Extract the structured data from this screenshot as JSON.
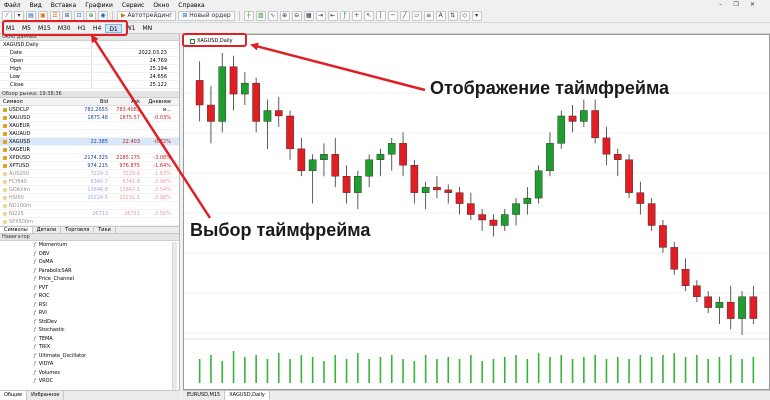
{
  "menu": [
    "Файл",
    "Вид",
    "Вставка",
    "Графики",
    "Сервис",
    "Окно",
    "Справка"
  ],
  "toolbar": {
    "algo_label": "Автотрейдинг",
    "new_order_label": "Новый ордер"
  },
  "timeframes": [
    "M1",
    "M5",
    "M15",
    "M30",
    "H1",
    "H4",
    "D1",
    "W1",
    "MN"
  ],
  "active_timeframe": "D1",
  "data_window": {
    "title": "Окно данных",
    "symbol": "XAGUSD,Daily",
    "rows": [
      {
        "k": "Date",
        "v": "2022.03.23"
      },
      {
        "k": "Open",
        "v": "24.769"
      },
      {
        "k": "High",
        "v": "25.194"
      },
      {
        "k": "Low",
        "v": "24.656"
      },
      {
        "k": "Close",
        "v": "25.122"
      }
    ]
  },
  "market_watch": {
    "title": "Обзор рынка: 19:38:36",
    "headers": [
      "Символ",
      "Bid",
      "Ask",
      "Дневное и..."
    ],
    "rows": [
      {
        "s": "USDCLP",
        "b": "782.2655",
        "a": "783.4083",
        "d": "",
        "dim": false
      },
      {
        "s": "XAUUSD",
        "b": "1875.48",
        "a": "1875.57",
        "d": "-0.03%",
        "dim": false
      },
      {
        "s": "XAUEUR",
        "b": "",
        "a": "",
        "d": "",
        "dim": false
      },
      {
        "s": "XAUAUD",
        "b": "",
        "a": "",
        "d": "",
        "dim": false
      },
      {
        "s": "XAGUSD",
        "b": "22.385",
        "a": "22.403",
        "d": "-0.72%",
        "dim": false
      },
      {
        "s": "XAGEUR",
        "b": "",
        "a": "",
        "d": "",
        "dim": false
      },
      {
        "s": "XPDUSD",
        "b": "2174.325",
        "a": "2185.175",
        "d": "-3.08%",
        "dim": false
      },
      {
        "s": "XPTUSD",
        "b": "974.215",
        "a": "976.875",
        "d": "-1.64%",
        "dim": false
      },
      {
        "s": "AUS200",
        "b": "7224.3",
        "a": "7229.6",
        "d": "-1.63%",
        "dim": true
      },
      {
        "s": "FCHI40",
        "b": "6340.7",
        "a": "6341.8",
        "d": "-2.96%",
        "dim": true
      },
      {
        "s": "GDAXIm",
        "b": "13846.8",
        "a": "13847.5",
        "d": "-2.54%",
        "dim": true
      },
      {
        "s": "HSI50",
        "b": "20224.5",
        "a": "20231.5",
        "d": "-2.98%",
        "dim": true
      },
      {
        "s": "ND100m",
        "b": "",
        "a": "",
        "d": "",
        "dim": true
      },
      {
        "s": "NI225",
        "b": "26713",
        "a": "26721",
        "d": "-2.58%",
        "dim": true
      },
      {
        "s": "SPX500m",
        "b": "",
        "a": "",
        "d": "",
        "dim": true
      }
    ],
    "tabs": [
      "Символы",
      "Детали",
      "Торговля",
      "Тики"
    ]
  },
  "navigator": {
    "title": "Навигатор",
    "items": [
      "Momentum",
      "OBV",
      "OsMA",
      "ParabolicSAR",
      "Price_Channel",
      "PVT",
      "ROC",
      "RSI",
      "RVI",
      "StdDev",
      "Stochastic",
      "TEMA",
      "TRIX",
      "Ultimate_Oscillator",
      "VIDYA",
      "Volumes",
      "VROC"
    ],
    "tabs": [
      "Общие",
      "Избранное"
    ]
  },
  "chart": {
    "tab_label": "XAGUSD,Daily",
    "bottom_tabs": [
      "EURUSD,M15",
      "XAGUSD,Daily"
    ],
    "colors": {
      "bull": "#1f9d2f",
      "bear": "#e01e24",
      "volume": "#36b536",
      "grid": "#e6e6e6"
    }
  },
  "chart_data": {
    "type": "candlestick",
    "candles": [
      [
        0.85,
        0.92,
        0.7,
        0.76
      ],
      [
        0.76,
        0.83,
        0.62,
        0.7
      ],
      [
        0.7,
        0.95,
        0.66,
        0.9
      ],
      [
        0.9,
        0.94,
        0.74,
        0.8
      ],
      [
        0.8,
        0.88,
        0.76,
        0.84
      ],
      [
        0.84,
        0.86,
        0.66,
        0.7
      ],
      [
        0.7,
        0.78,
        0.6,
        0.74
      ],
      [
        0.74,
        0.79,
        0.68,
        0.72
      ],
      [
        0.72,
        0.74,
        0.56,
        0.6
      ],
      [
        0.6,
        0.64,
        0.5,
        0.52
      ],
      [
        0.52,
        0.58,
        0.4,
        0.56
      ],
      [
        0.56,
        0.62,
        0.5,
        0.58
      ],
      [
        0.58,
        0.64,
        0.46,
        0.5
      ],
      [
        0.5,
        0.54,
        0.4,
        0.44
      ],
      [
        0.44,
        0.52,
        0.38,
        0.5
      ],
      [
        0.5,
        0.58,
        0.46,
        0.56
      ],
      [
        0.56,
        0.6,
        0.5,
        0.58
      ],
      [
        0.58,
        0.64,
        0.52,
        0.62
      ],
      [
        0.62,
        0.66,
        0.5,
        0.54
      ],
      [
        0.54,
        0.56,
        0.4,
        0.44
      ],
      [
        0.44,
        0.48,
        0.38,
        0.46
      ],
      [
        0.46,
        0.5,
        0.42,
        0.45
      ],
      [
        0.45,
        0.47,
        0.4,
        0.44
      ],
      [
        0.44,
        0.46,
        0.36,
        0.4
      ],
      [
        0.4,
        0.44,
        0.34,
        0.36
      ],
      [
        0.36,
        0.38,
        0.3,
        0.34
      ],
      [
        0.34,
        0.36,
        0.28,
        0.32
      ],
      [
        0.32,
        0.38,
        0.3,
        0.36
      ],
      [
        0.36,
        0.42,
        0.32,
        0.4
      ],
      [
        0.4,
        0.46,
        0.36,
        0.42
      ],
      [
        0.42,
        0.54,
        0.4,
        0.52
      ],
      [
        0.52,
        0.66,
        0.5,
        0.62
      ],
      [
        0.62,
        0.74,
        0.6,
        0.72
      ],
      [
        0.72,
        0.76,
        0.66,
        0.7
      ],
      [
        0.7,
        0.78,
        0.68,
        0.74
      ],
      [
        0.74,
        0.78,
        0.62,
        0.64
      ],
      [
        0.64,
        0.68,
        0.54,
        0.58
      ],
      [
        0.58,
        0.6,
        0.5,
        0.56
      ],
      [
        0.56,
        0.58,
        0.42,
        0.44
      ],
      [
        0.44,
        0.48,
        0.36,
        0.4
      ],
      [
        0.4,
        0.42,
        0.3,
        0.32
      ],
      [
        0.32,
        0.34,
        0.22,
        0.24
      ],
      [
        0.24,
        0.26,
        0.14,
        0.16
      ],
      [
        0.16,
        0.2,
        0.08,
        0.1
      ],
      [
        0.1,
        0.12,
        0.04,
        0.06
      ],
      [
        0.06,
        0.08,
        0.0,
        0.02
      ],
      [
        0.02,
        0.06,
        -0.04,
        0.04
      ],
      [
        0.04,
        0.1,
        -0.06,
        -0.02
      ],
      [
        -0.02,
        0.08,
        -0.08,
        0.06
      ],
      [
        0.06,
        0.1,
        -0.04,
        -0.02
      ]
    ],
    "volumes": [
      0.6,
      0.7,
      0.55,
      0.8,
      0.65,
      0.7,
      0.6,
      0.75,
      0.6,
      0.7,
      0.65,
      0.55,
      0.7,
      0.6,
      0.75,
      0.6,
      0.65,
      0.7,
      0.6,
      0.55,
      0.7,
      0.6,
      0.65,
      0.6,
      0.7,
      0.55,
      0.6,
      0.65,
      0.7,
      0.6,
      0.75,
      0.65,
      0.7,
      0.6,
      0.65,
      0.7,
      0.6,
      0.65,
      0.6,
      0.7,
      0.65,
      0.7,
      0.75,
      0.65,
      0.7,
      0.6,
      0.65,
      0.7,
      0.6,
      0.65
    ]
  },
  "annotations": {
    "timeframe_display": "Отображение таймфрейма",
    "timeframe_select": "Выбор таймфрейма"
  }
}
